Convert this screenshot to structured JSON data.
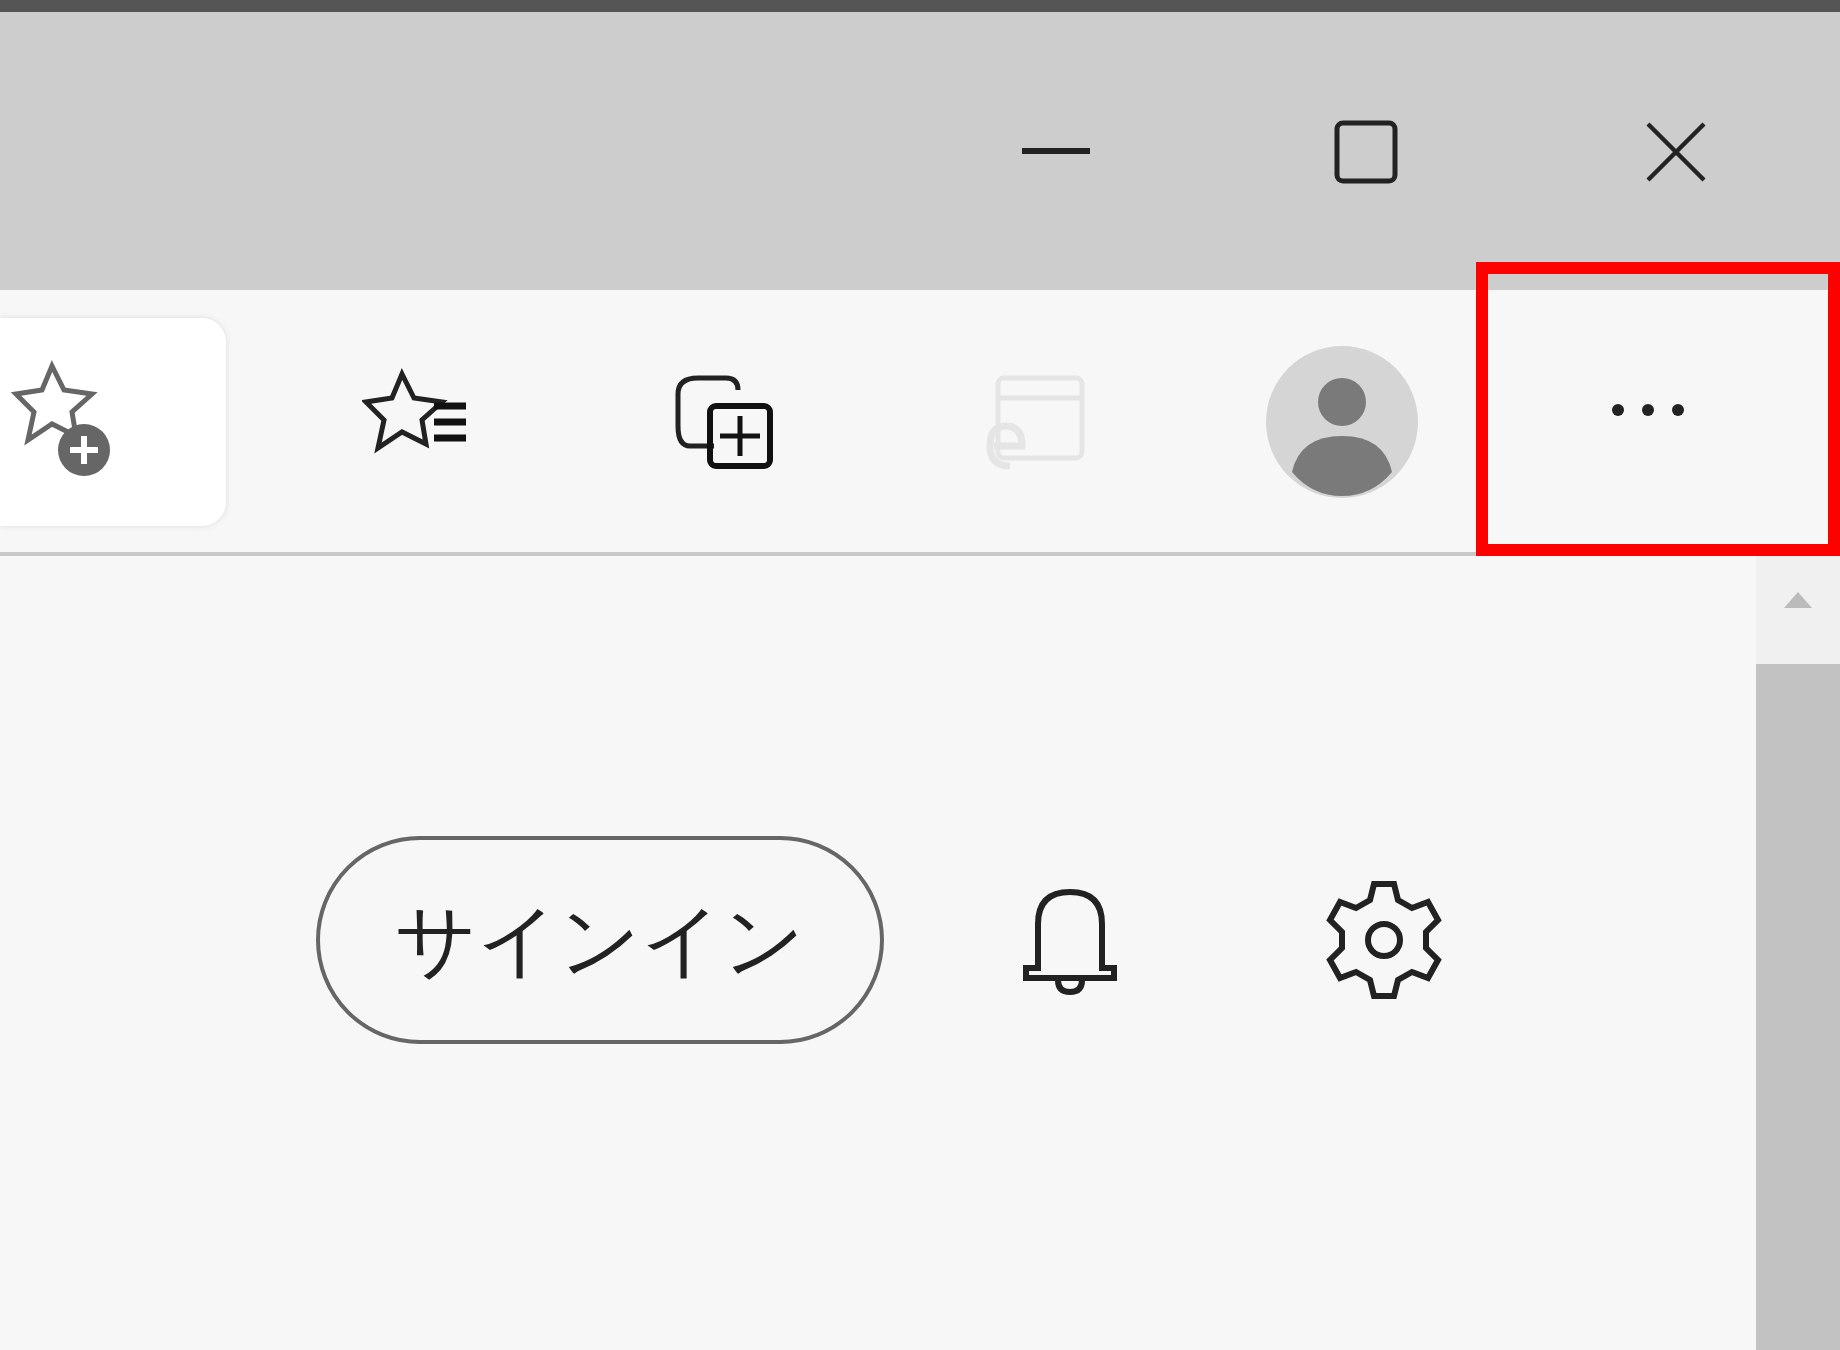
{
  "title_bar": {
    "controls": [
      {
        "kind": "minimize"
      },
      {
        "kind": "maximize"
      },
      {
        "kind": "close"
      }
    ]
  },
  "toolbar": {
    "address_bar": {
      "actions": [
        {
          "kind": "favorite-add"
        }
      ]
    },
    "items": [
      {
        "kind": "favorites",
        "disabled": false
      },
      {
        "kind": "collections",
        "disabled": false
      },
      {
        "kind": "ie-mode",
        "disabled": true
      },
      {
        "kind": "profile",
        "disabled": false
      }
    ],
    "more_button": {
      "highlighted": true
    }
  },
  "content": {
    "sign_in_button": {
      "label": "サインイン"
    },
    "icons": [
      {
        "kind": "notifications"
      },
      {
        "kind": "settings"
      }
    ]
  }
}
